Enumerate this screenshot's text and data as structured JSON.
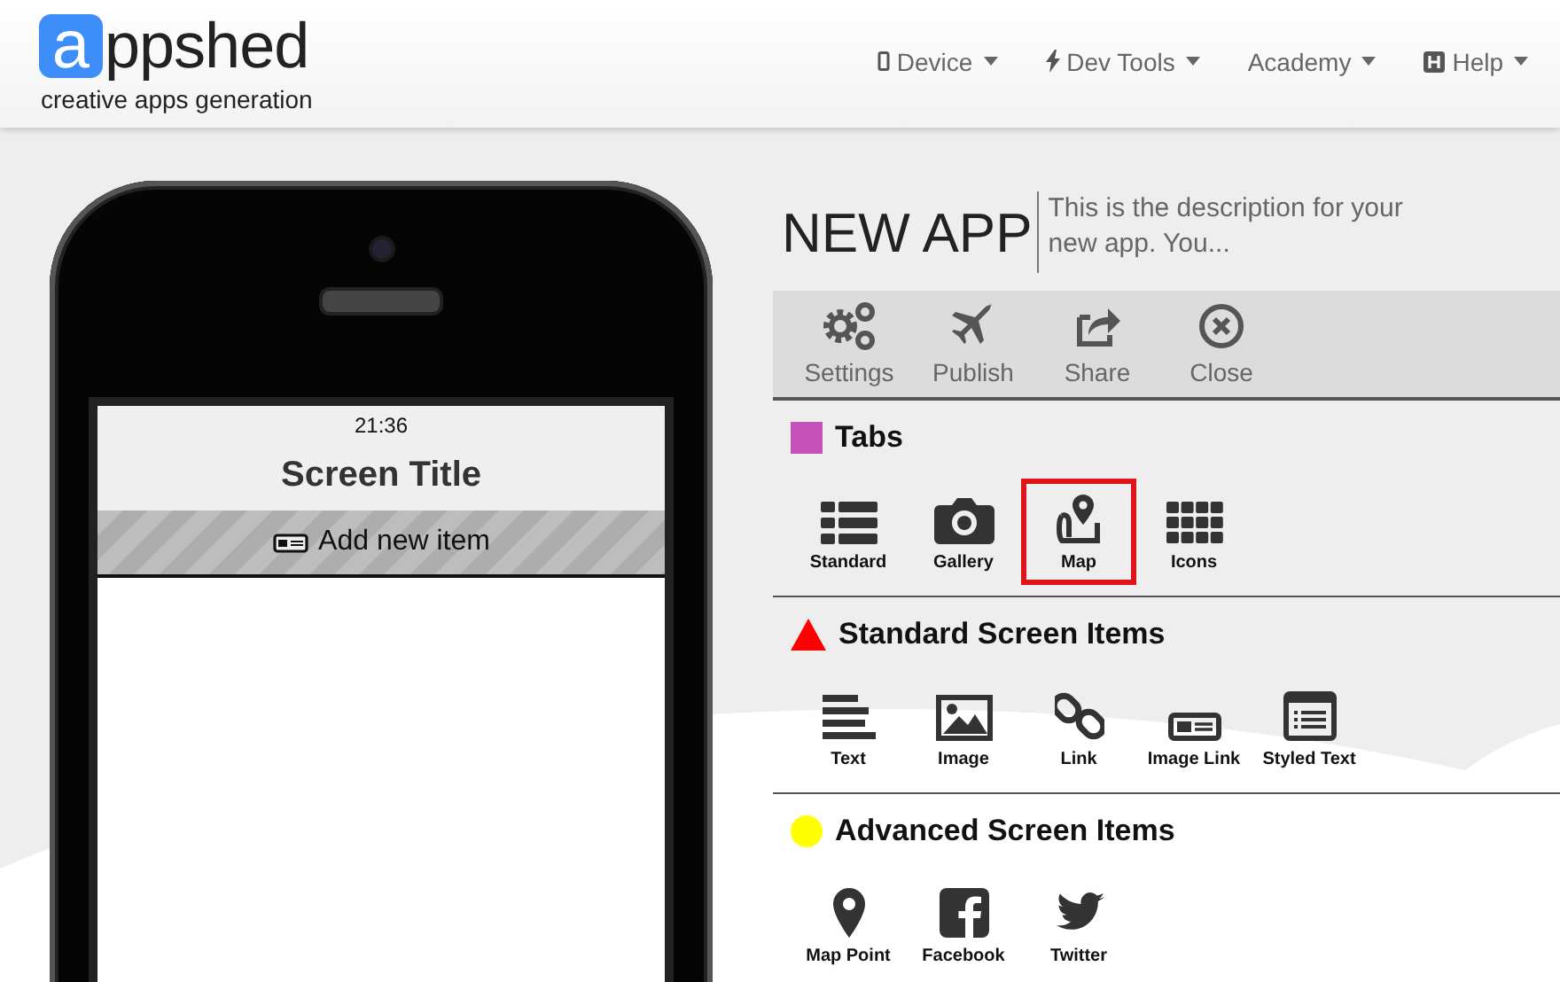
{
  "logo": {
    "letter": "a",
    "text": "ppshed",
    "tagline": "creative apps generation"
  },
  "nav": [
    {
      "label": "Device"
    },
    {
      "label": "Dev Tools"
    },
    {
      "label": "Academy"
    },
    {
      "label": "Help"
    }
  ],
  "phone": {
    "time": "21:36",
    "screen_title": "Screen Title",
    "add_item": "Add new item"
  },
  "app": {
    "title": "NEW APP",
    "description": "This is the description for your new app. You..."
  },
  "toolbar": [
    {
      "label": "Settings"
    },
    {
      "label": "Publish"
    },
    {
      "label": "Share"
    },
    {
      "label": "Close"
    }
  ],
  "sections": [
    {
      "title": "Tabs",
      "kind": "square",
      "color": "#c552b9",
      "items": [
        {
          "label": "Standard",
          "highlighted": false
        },
        {
          "label": "Gallery",
          "highlighted": false
        },
        {
          "label": "Map",
          "highlighted": true
        },
        {
          "label": "Icons",
          "highlighted": false
        }
      ]
    },
    {
      "title": "Standard Screen Items",
      "kind": "triangle",
      "color": "#ff0000",
      "items": [
        {
          "label": "Text",
          "highlighted": false
        },
        {
          "label": "Image",
          "highlighted": false
        },
        {
          "label": "Link",
          "highlighted": false
        },
        {
          "label": "Image Link",
          "highlighted": false
        },
        {
          "label": "Styled Text",
          "highlighted": false
        }
      ]
    },
    {
      "title": "Advanced Screen Items",
      "kind": "circle",
      "color": "#ffff00",
      "items": [
        {
          "label": "Map Point",
          "highlighted": false
        },
        {
          "label": "Facebook",
          "highlighted": false
        },
        {
          "label": "Twitter",
          "highlighted": false
        }
      ]
    }
  ]
}
